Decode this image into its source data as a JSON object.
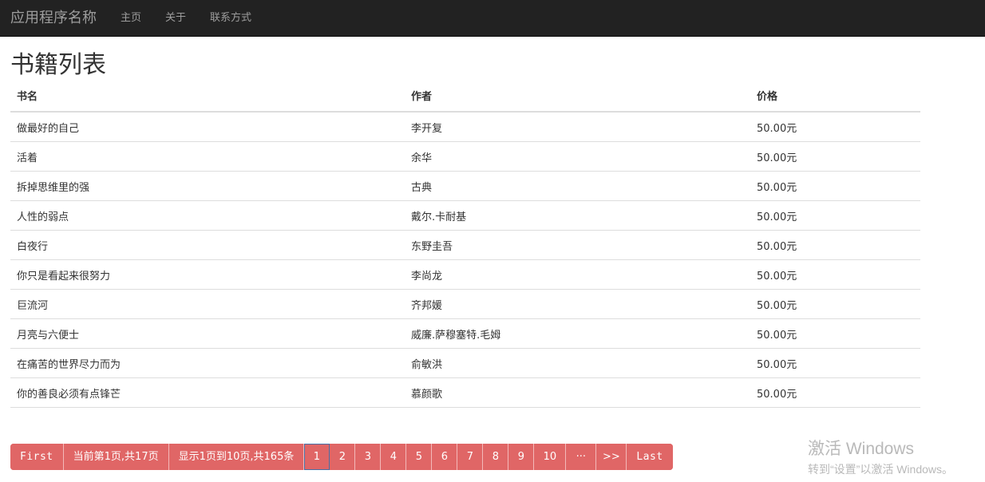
{
  "nav": {
    "brand": "应用程序名称",
    "links": [
      "主页",
      "关于",
      "联系方式"
    ]
  },
  "page": {
    "title": "书籍列表"
  },
  "table": {
    "headers": [
      "书名",
      "作者",
      "价格"
    ],
    "rows": [
      [
        "做最好的自己",
        "李开复",
        "50.00元"
      ],
      [
        "活着",
        "余华",
        "50.00元"
      ],
      [
        "拆掉思维里的强",
        "古典",
        "50.00元"
      ],
      [
        "人性的弱点",
        "戴尔.卡耐基",
        "50.00元"
      ],
      [
        "白夜行",
        "东野圭吾",
        "50.00元"
      ],
      [
        "你只是看起来很努力",
        "李尚龙",
        "50.00元"
      ],
      [
        "巨流河",
        "齐邦媛",
        "50.00元"
      ],
      [
        "月亮与六便士",
        "威廉.萨穆塞特.毛姆",
        "50.00元"
      ],
      [
        "在痛苦的世界尽力而为",
        "俞敏洪",
        "50.00元"
      ],
      [
        "你的善良必须有点锋芒",
        "慕颜歌",
        "50.00元"
      ]
    ]
  },
  "pagination": {
    "first": "First",
    "current_info": "当前第1页,共17页",
    "range_info": "显示1页到10页,共165条",
    "pages": [
      "1",
      "2",
      "3",
      "4",
      "5",
      "6",
      "7",
      "8",
      "9",
      "10"
    ],
    "active_page": "1",
    "ellipsis": "···",
    "next": ">>",
    "last": "Last"
  },
  "watermark": {
    "line1": "激活 Windows",
    "line2": "转到“设置”以激活 Windows。"
  },
  "colors": {
    "navbar_bg": "#222222",
    "pager_bg": "#e06666",
    "active_outline": "#4a6fa5"
  }
}
